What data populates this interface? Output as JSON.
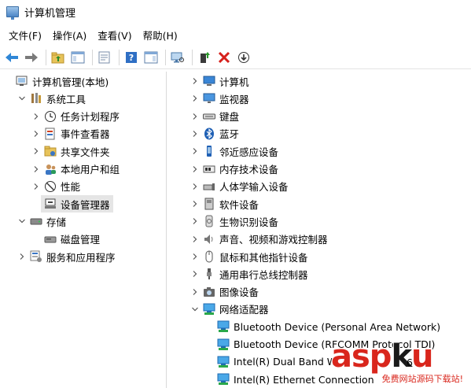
{
  "window": {
    "title": "计算机管理"
  },
  "menu": [
    "文件(F)",
    "操作(A)",
    "查看(V)",
    "帮助(H)"
  ],
  "toolbar": [
    {
      "name": "back-icon"
    },
    {
      "name": "forward-icon"
    },
    {
      "sep": true
    },
    {
      "name": "up-folder-icon"
    },
    {
      "name": "show-tree-icon"
    },
    {
      "sep": true
    },
    {
      "name": "properties-icon"
    },
    {
      "sep": true
    },
    {
      "name": "help-icon"
    },
    {
      "name": "action-pane-icon"
    },
    {
      "sep": true
    },
    {
      "name": "scan-hardware-icon"
    },
    {
      "sep": true
    },
    {
      "name": "update-driver-icon"
    },
    {
      "name": "uninstall-icon"
    },
    {
      "name": "disable-icon"
    }
  ],
  "left_tree": [
    {
      "label": "计算机管理(本地)",
      "level": 0,
      "expander": "none",
      "icon": "computer-mgmt-icon"
    },
    {
      "label": "系统工具",
      "level": 1,
      "expander": "expanded",
      "icon": "system-tools-icon"
    },
    {
      "label": "任务计划程序",
      "level": 2,
      "expander": "collapsed",
      "icon": "task-scheduler-icon"
    },
    {
      "label": "事件查看器",
      "level": 2,
      "expander": "collapsed",
      "icon": "event-viewer-icon"
    },
    {
      "label": "共享文件夹",
      "level": 2,
      "expander": "collapsed",
      "icon": "shared-folders-icon"
    },
    {
      "label": "本地用户和组",
      "level": 2,
      "expander": "collapsed",
      "icon": "local-users-icon"
    },
    {
      "label": "性能",
      "level": 2,
      "expander": "collapsed",
      "icon": "performance-icon"
    },
    {
      "label": "设备管理器",
      "level": 2,
      "expander": "none",
      "icon": "device-manager-icon",
      "selected": true
    },
    {
      "label": "存储",
      "level": 1,
      "expander": "expanded",
      "icon": "storage-icon"
    },
    {
      "label": "磁盘管理",
      "level": 2,
      "expander": "none",
      "icon": "disk-management-icon"
    },
    {
      "label": "服务和应用程序",
      "level": 1,
      "expander": "collapsed",
      "icon": "services-apps-icon"
    }
  ],
  "right_tree": [
    {
      "label": "计算机",
      "level": 0,
      "expander": "collapsed",
      "icon": "computer-icon"
    },
    {
      "label": "监视器",
      "level": 0,
      "expander": "collapsed",
      "icon": "monitor-icon"
    },
    {
      "label": "键盘",
      "level": 0,
      "expander": "collapsed",
      "icon": "keyboard-icon"
    },
    {
      "label": "蓝牙",
      "level": 0,
      "expander": "collapsed",
      "icon": "bluetooth-icon"
    },
    {
      "label": "邻近感应设备",
      "level": 0,
      "expander": "collapsed",
      "icon": "proximity-icon"
    },
    {
      "label": "内存技术设备",
      "level": 0,
      "expander": "collapsed",
      "icon": "memory-device-icon"
    },
    {
      "label": "人体学输入设备",
      "level": 0,
      "expander": "collapsed",
      "icon": "hid-icon"
    },
    {
      "label": "软件设备",
      "level": 0,
      "expander": "collapsed",
      "icon": "software-device-icon"
    },
    {
      "label": "生物识别设备",
      "level": 0,
      "expander": "collapsed",
      "icon": "biometric-icon"
    },
    {
      "label": "声音、视频和游戏控制器",
      "level": 0,
      "expander": "collapsed",
      "icon": "sound-icon"
    },
    {
      "label": "鼠标和其他指针设备",
      "level": 0,
      "expander": "collapsed",
      "icon": "mouse-icon"
    },
    {
      "label": "通用串行总线控制器",
      "level": 0,
      "expander": "collapsed",
      "icon": "usb-icon"
    },
    {
      "label": "图像设备",
      "level": 0,
      "expander": "collapsed",
      "icon": "imaging-device-icon"
    },
    {
      "label": "网络适配器",
      "level": 0,
      "expander": "expanded",
      "icon": "network-adapter-icon"
    },
    {
      "label": "Bluetooth Device (Personal Area Network)",
      "level": 1,
      "expander": "none",
      "icon": "network-adapter-icon"
    },
    {
      "label": "Bluetooth Device (RFCOMM Protocol TDI)",
      "level": 1,
      "expander": "none",
      "icon": "network-adapter-icon"
    },
    {
      "label": "Intel(R) Dual Band W",
      "level": 1,
      "expander": "none",
      "icon": "network-adapter-icon"
    },
    {
      "label": "Intel(R) Ethernet Connection",
      "level": 1,
      "expander": "none",
      "icon": "network-adapter-icon"
    }
  ],
  "watermark": {
    "logo_main": "asp",
    "logo_k": "k",
    "logo_tail": "u",
    "suffix": "6",
    "tagline": "免费网站源码下载站!"
  },
  "colors": {
    "selected_bg": "#e5e5e5",
    "accent": "#1e73be",
    "watermark_red": "#d9261c"
  }
}
